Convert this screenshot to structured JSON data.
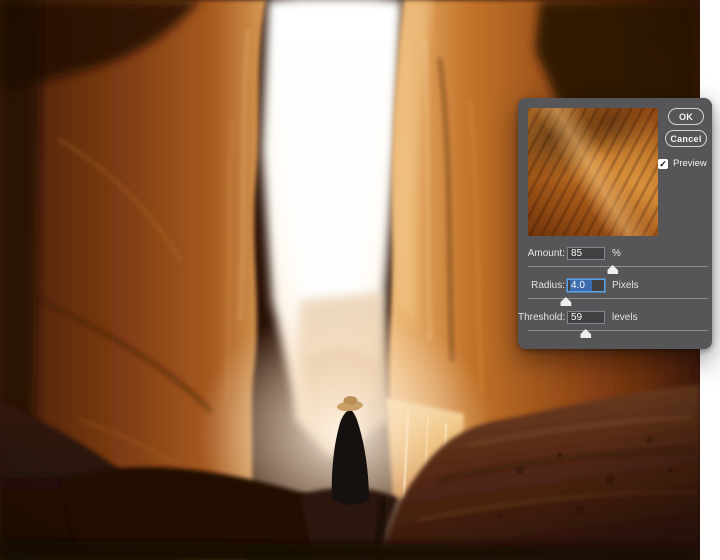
{
  "canvas": {
    "background": "#ffffff"
  },
  "photo": {
    "alt": "Slot canyon with towering orange rock walls, a bright vertical shaft of light, and a figure in a dark cloak and straw hat standing on rocks",
    "palette": {
      "wall_orange": "#a85a20",
      "wall_dark": "#2a1106",
      "light_shaft": "#fffaf2",
      "foreground_rock": "#552a15",
      "hat_tan": "#c9a068",
      "cloak_black": "#16100e"
    }
  },
  "dialog": {
    "bg": "#565659",
    "accent_blue": "#5aa4e6",
    "selection_blue": "#3c6cb0",
    "buttons": {
      "ok": "OK",
      "cancel": "Cancel"
    },
    "preview": {
      "label": "Preview",
      "checked": true
    },
    "fields": [
      {
        "label": "Amount:",
        "value": "85",
        "unit": "%",
        "slider_percent": 47,
        "focused": false,
        "value_selected": false
      },
      {
        "label": "Radius:",
        "value": "4.0",
        "unit": "Pixels",
        "slider_percent": 21,
        "focused": true,
        "value_selected": true
      },
      {
        "label": "Threshold:",
        "value": "59",
        "unit": "levels",
        "slider_percent": 32,
        "focused": false,
        "value_selected": false
      }
    ]
  },
  "icons": {
    "check": "✓"
  }
}
